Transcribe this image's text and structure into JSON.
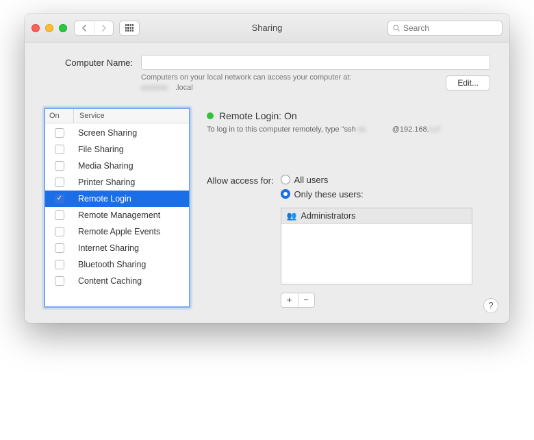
{
  "window": {
    "title": "Sharing"
  },
  "search": {
    "placeholder": "Search"
  },
  "computer_name": {
    "label": "Computer Name:"
  },
  "hostname": {
    "line1": "Computers on your local network can access your computer at:",
    "line2_suffix": ".local"
  },
  "edit_label": "Edit...",
  "list_headers": {
    "on": "On",
    "service": "Service"
  },
  "services": [
    {
      "label": "Screen Sharing",
      "checked": false,
      "selected": false
    },
    {
      "label": "File Sharing",
      "checked": false,
      "selected": false
    },
    {
      "label": "Media Sharing",
      "checked": false,
      "selected": false
    },
    {
      "label": "Printer Sharing",
      "checked": false,
      "selected": false
    },
    {
      "label": "Remote Login",
      "checked": true,
      "selected": true
    },
    {
      "label": "Remote Management",
      "checked": false,
      "selected": false
    },
    {
      "label": "Remote Apple Events",
      "checked": false,
      "selected": false
    },
    {
      "label": "Internet Sharing",
      "checked": false,
      "selected": false
    },
    {
      "label": "Bluetooth Sharing",
      "checked": false,
      "selected": false
    },
    {
      "label": "Content Caching",
      "checked": false,
      "selected": false
    }
  ],
  "detail": {
    "status": "Remote Login: On",
    "login_prefix": "To log in to this computer remotely, type \"ssh",
    "login_host": "@192.168.",
    "access_label": "Allow access for:",
    "radio_all": "All users",
    "radio_only": "Only these users:",
    "users": [
      "Administrators"
    ]
  },
  "help": "?"
}
